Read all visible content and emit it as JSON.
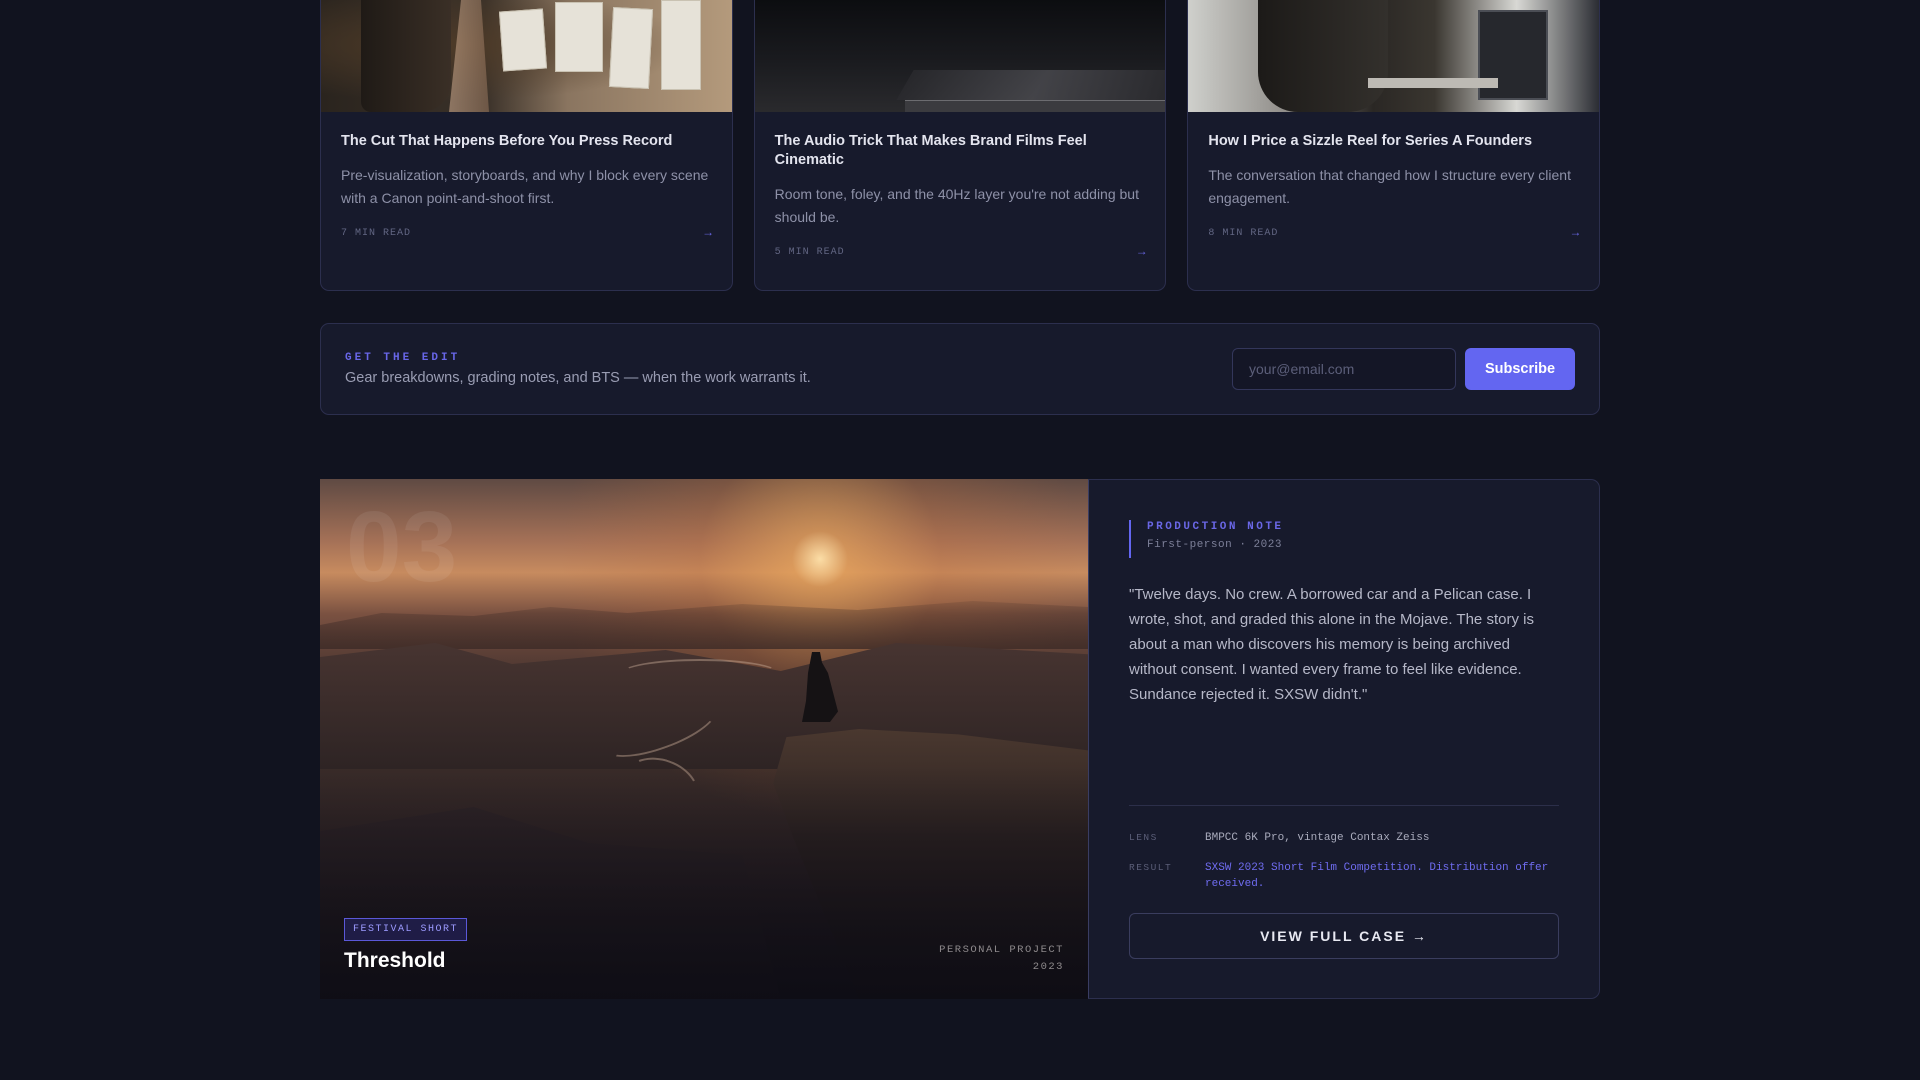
{
  "articles": [
    {
      "title": "The Cut That Happens Before You Press Record",
      "description": "Pre-visualization, storyboards, and why I block every scene with a Canon point-and-shoot first.",
      "read_time": "7 MIN READ",
      "arrow": "→"
    },
    {
      "title": "The Audio Trick That Makes Brand Films Feel Cinematic",
      "description": "Room tone, foley, and the 40Hz layer you're not adding but should be.",
      "read_time": "5 MIN READ",
      "arrow": "→"
    },
    {
      "title": "How I Price a Sizzle Reel for Series A Founders",
      "description": "The conversation that changed how I structure every client engagement.",
      "read_time": "8 MIN READ",
      "arrow": "→"
    }
  ],
  "newsletter": {
    "eyebrow": "GET THE EDIT",
    "text": "Gear breakdowns, grading notes, and BTS — when the work warrants it.",
    "email_placeholder": "your@email.com",
    "subscribe_label": "Subscribe",
    "accent_color": "#6366f1"
  },
  "project": {
    "number": "03",
    "badge": "FESTIVAL SHORT",
    "title": "Threshold",
    "meta_line1": "PERSONAL PROJECT",
    "meta_line2": "2023",
    "note_eyebrow": "PRODUCTION NOTE",
    "note_sub": "First-person · 2023",
    "quote": "\"Twelve days. No crew. A borrowed car and a Pelican case. I wrote, shot, and graded this alone in the Mojave. The story is about a man who discovers his memory is being archived without consent. I wanted every frame to feel like evidence. Sundance rejected it. SXSW didn't.\"",
    "specs": [
      {
        "label": "LENS",
        "value": "BMPCC 6K Pro, vintage Contax Zeiss"
      },
      {
        "label": "RESULT",
        "value": "SXSW 2023 Short Film Competition. Distribution offer received."
      }
    ],
    "cta_label": "VIEW FULL CASE →"
  }
}
